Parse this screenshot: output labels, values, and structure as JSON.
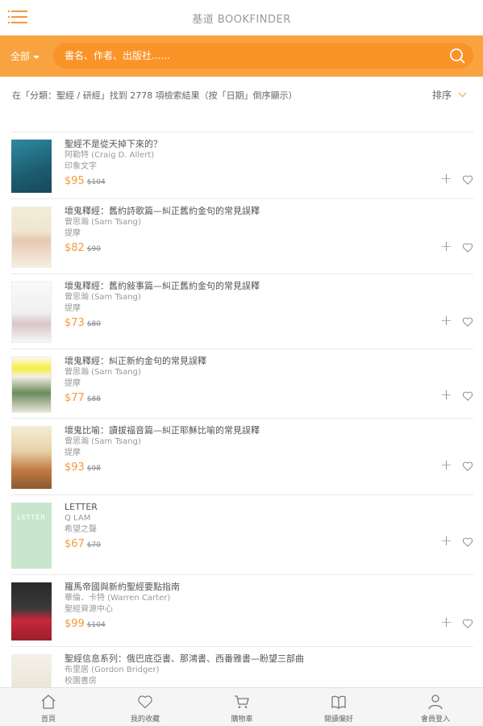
{
  "header": {
    "app_title": "基道 BOOKFINDER",
    "menu_icon": "hamburger-icon"
  },
  "search": {
    "scope_label": "全部",
    "placeholder": "書名、作者、出版社......"
  },
  "results": {
    "summary": "在「分類：聖經 / 研經」找到 2778 項檢索結果（按「日期」倒序顯示）",
    "sort_label": "排序"
  },
  "books": [
    {
      "title": "聖經不是從天掉下來的？",
      "author": "阿勒特 (Craig D. Allert)",
      "publisher": "印象文字",
      "price": "$95",
      "old_price": "$104",
      "cover": [
        "#2f8aa0",
        "#19475a"
      ]
    },
    {
      "title": "壞鬼釋經：舊約詩歌篇—糾正舊約金句的常見誤釋",
      "author": "曾思瀚 (Sam Tsang)",
      "publisher": "提摩",
      "price": "$82",
      "old_price": "$90",
      "cover": [
        "#f2ecd8",
        "#cc5a3d"
      ]
    },
    {
      "title": "壞鬼釋經：舊約敍事篇—糾正舊約金句的常見誤釋",
      "author": "曾思瀚 (Sam Tsang)",
      "publisher": "提摩",
      "price": "$73",
      "old_price": "$80",
      "cover": [
        "#f4f4f4",
        "#c0392b"
      ]
    },
    {
      "title": "壞鬼釋經：糾正新約金句的常見誤釋",
      "author": "曾思瀚 (Sam Tsang)",
      "publisher": "提摩",
      "price": "$77",
      "old_price": "$88",
      "cover": [
        "#f3f0e4",
        "#3a6b35"
      ]
    },
    {
      "title": "壞鬼比喻：讀拔福音篇—糾正耶穌比喻的常見誤釋",
      "author": "曾思瀚 (Sam Tsang)",
      "publisher": "提摩",
      "price": "$93",
      "old_price": "$98",
      "cover": [
        "#f2e8d2",
        "#b4562e"
      ]
    },
    {
      "title": "LETTER",
      "author": "Q LAM",
      "publisher": "希望之聲",
      "price": "$67",
      "old_price": "$70",
      "cover": [
        "#c8e6cd",
        "#b0d8b8"
      ]
    },
    {
      "title": "羅馬帝國與新約聖經要點指南",
      "author": "華倫．卡特 (Warren Carter)",
      "publisher": "聖經資源中心",
      "price": "$99",
      "old_price": "$104",
      "cover": [
        "#3a3a3a",
        "#c8283a"
      ]
    },
    {
      "title": "聖經信息系列：俄巴底亞書、那鴻書、西番雅書—盼望三部曲",
      "author": "布里居 (Gordon Bridger)",
      "publisher": "校園書房",
      "price": "",
      "old_price": "",
      "cover": [
        "#f0ede4",
        "#8c7d6a"
      ]
    }
  ],
  "tabs": [
    {
      "label": "首頁",
      "icon": "home-icon"
    },
    {
      "label": "我的收藏",
      "icon": "heart-icon"
    },
    {
      "label": "購物車",
      "icon": "cart-icon"
    },
    {
      "label": "閱讀偏好",
      "icon": "book-icon"
    },
    {
      "label": "會員登入",
      "icon": "user-icon"
    }
  ],
  "colors": {
    "accent": "#f9a340",
    "search_field": "#fa9328",
    "price": "#f5993a"
  }
}
